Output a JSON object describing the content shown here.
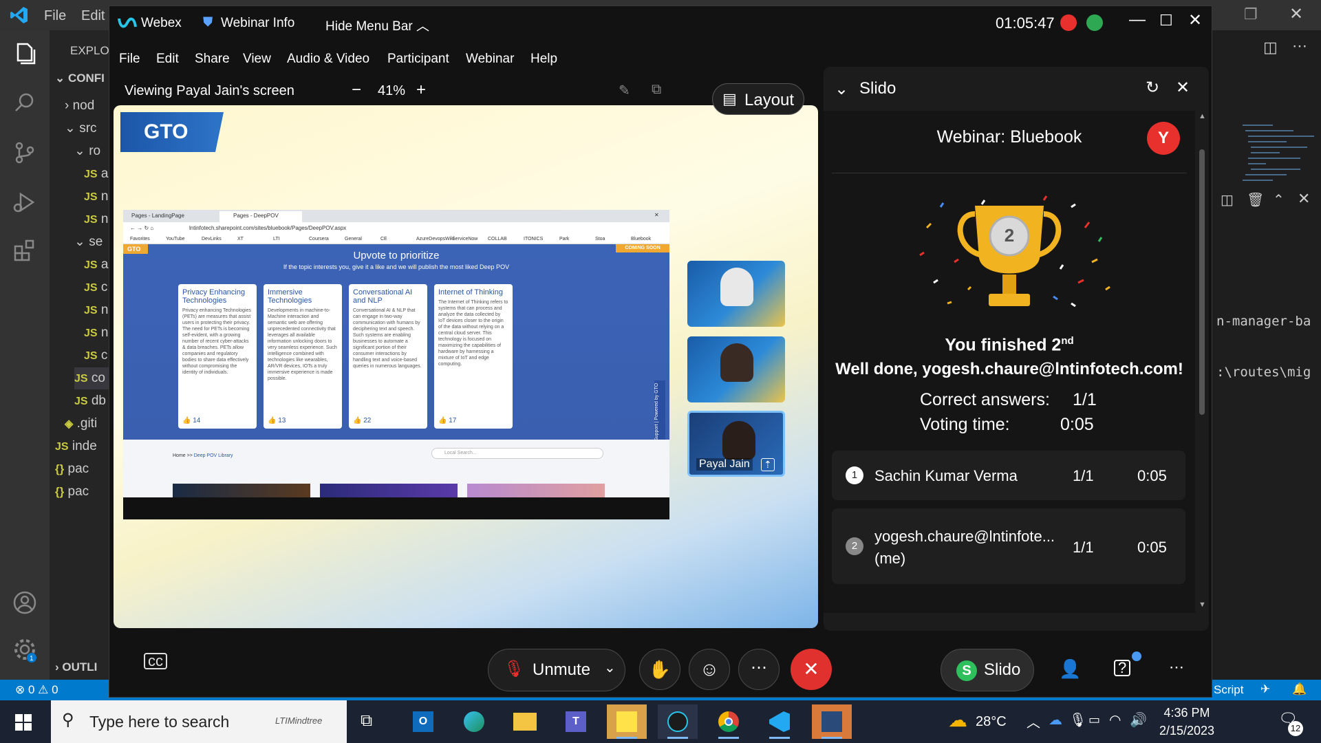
{
  "vscode": {
    "menu": [
      "File",
      "Edit"
    ],
    "explorer_label": "EXPLOR",
    "section_label": "CONFI",
    "tree": [
      {
        "indent": 1,
        "chevron": "›",
        "icon": "",
        "label": "nod"
      },
      {
        "indent": 1,
        "chevron": "⌄",
        "icon": "",
        "label": "src"
      },
      {
        "indent": 2,
        "chevron": "⌄",
        "icon": "",
        "label": "ro"
      },
      {
        "indent": 3,
        "chevron": "",
        "icon": "JS",
        "label": "a"
      },
      {
        "indent": 3,
        "chevron": "",
        "icon": "JS",
        "label": "n"
      },
      {
        "indent": 3,
        "chevron": "",
        "icon": "JS",
        "label": "n"
      },
      {
        "indent": 2,
        "chevron": "⌄",
        "icon": "",
        "label": "se"
      },
      {
        "indent": 3,
        "chevron": "",
        "icon": "JS",
        "label": "a"
      },
      {
        "indent": 3,
        "chevron": "",
        "icon": "JS",
        "label": "c"
      },
      {
        "indent": 3,
        "chevron": "",
        "icon": "JS",
        "label": "n"
      },
      {
        "indent": 3,
        "chevron": "",
        "icon": "JS",
        "label": "n"
      },
      {
        "indent": 3,
        "chevron": "",
        "icon": "JS",
        "label": "c"
      },
      {
        "indent": 2,
        "chevron": "",
        "icon": "JS",
        "label": "co"
      },
      {
        "indent": 2,
        "chevron": "",
        "icon": "JS",
        "label": "db"
      },
      {
        "indent": 1,
        "chevron": "",
        "icon": "◈",
        "label": ".giti"
      },
      {
        "indent": 0,
        "chevron": "",
        "icon": "JS",
        "label": "inde"
      },
      {
        "indent": 0,
        "chevron": "",
        "icon": "{}",
        "label": "pac"
      },
      {
        "indent": 0,
        "chevron": "",
        "icon": "{}",
        "label": "pac"
      }
    ],
    "outline_label": "OUTLI",
    "terminal_lines": [
      "n-manager-ba",
      ":\\routes\\mig"
    ],
    "status": {
      "errors": "0",
      "warnings": "0",
      "language": "Script"
    }
  },
  "webex": {
    "app_name": "Webex",
    "webinar_info": "Webinar Info",
    "hide_menu": "Hide Menu Bar",
    "timer": "01:05:47",
    "menu": [
      "File",
      "Edit",
      "Share",
      "View",
      "Audio & Video",
      "Participant",
      "Webinar",
      "Help"
    ],
    "viewing": "Viewing Payal Jain's screen",
    "zoom": "41%",
    "layout_label": "Layout",
    "shared": {
      "logo": "GTO",
      "tabs": [
        "Pages - LandingPage",
        "Pages - DeepPOV"
      ],
      "url": "lntinfotech.sharepoint.com/sites/bluebook/Pages/DeepPOV.aspx",
      "bookmarks": [
        "Favorites",
        "YouTube",
        "DevLinks",
        "XT",
        "LTI",
        "Coursera",
        "General",
        "CE",
        "AzureDevopsWiki",
        "ServiceNow",
        "COLLAB",
        "ITONICS",
        "Park",
        "Stoa",
        "Bluebook"
      ],
      "gto_badge": "GTO",
      "coming_soon": "COMING SOON",
      "heading": "Upvote to prioritize",
      "subheading": "If the topic interests you, give it a like and we will publish the most liked Deep POV",
      "cards": [
        {
          "title": "Privacy Enhancing Technologies",
          "body": "Privacy enhancing Technologies (PETs) are measures that assist users in protecting their privacy. The need for PETs is becoming self-evident, with a growing number of recent cyber-attacks & data breaches. PETs allow companies and regulatory bodies to share data effectively without compromising the identity of individuals.",
          "likes": "14"
        },
        {
          "title": "Immersive Technologies",
          "body": "Developments in machine-to-Machine interaction and semantic web are offering unprecedented connectivity that leverages all available information unlocking doors to very seamless experience. Such intelligence combined with technologies like wearables, AR/VR devices, IOTs a truly immersive experience is made possible.",
          "likes": "13"
        },
        {
          "title": "Conversational AI and NLP",
          "body": "Conversational AI & NLP that can engage in two-way communication with humans by deciphering text and speech. Such systems are enabling businesses to automate a significant portion of their consumer interactions by handling text and voice-based queries in numerous languages.",
          "likes": "22"
        },
        {
          "title": "Internet of Thinking",
          "body": "The Internet of Thinking refers to systems that can process and analyze the data collected by IoT devices closer to the origin of the data without relying on a central cloud server. This technology is focused on maximizing the capabilities of hardware by harnessing a mixture of IoT and edge computing.",
          "likes": "17"
        }
      ],
      "side_tabs": [
        "Support",
        "Powered by GTO"
      ],
      "breadcrumb_home": "Home >>",
      "breadcrumb_current": "Deep POV Library",
      "search_placeholder": "Local Search..."
    },
    "participant_name": "Payal Jain",
    "controls": {
      "unmute": "Unmute",
      "slido": "Slido",
      "slido_icon": "S"
    }
  },
  "slido": {
    "title": "Slido",
    "webinar": "Webinar: Bluebook",
    "avatar": "Y",
    "rank_badge": "2",
    "finished": "You finished 2",
    "finished_sup": "nd",
    "well_done": "Well done, yogesh.chaure@lntinfotech.com!",
    "correct_label": "Correct answers:",
    "correct_value": "1/1",
    "voting_label": "Voting time:",
    "voting_value": "0:05",
    "leaderboard": [
      {
        "rank": "1",
        "name": "Sachin Kumar Verma",
        "name2": "",
        "score": "1/1",
        "time": "0:05"
      },
      {
        "rank": "2",
        "name": "yogesh.chaure@lntinfote...",
        "name2": "(me)",
        "score": "1/1",
        "time": "0:05"
      }
    ]
  },
  "taskbar": {
    "search_placeholder": "Type here to search",
    "search_brand": "LTIMindtree",
    "weather": "28°C",
    "time": "4:36 PM",
    "date": "2/15/2023",
    "notifications": "12"
  },
  "colors": {
    "accent": "#007acc",
    "slido_green": "#2ec05c",
    "leave_red": "#e0312f",
    "avatar_red": "#e8302c",
    "trophy_gold": "#f2b320"
  }
}
